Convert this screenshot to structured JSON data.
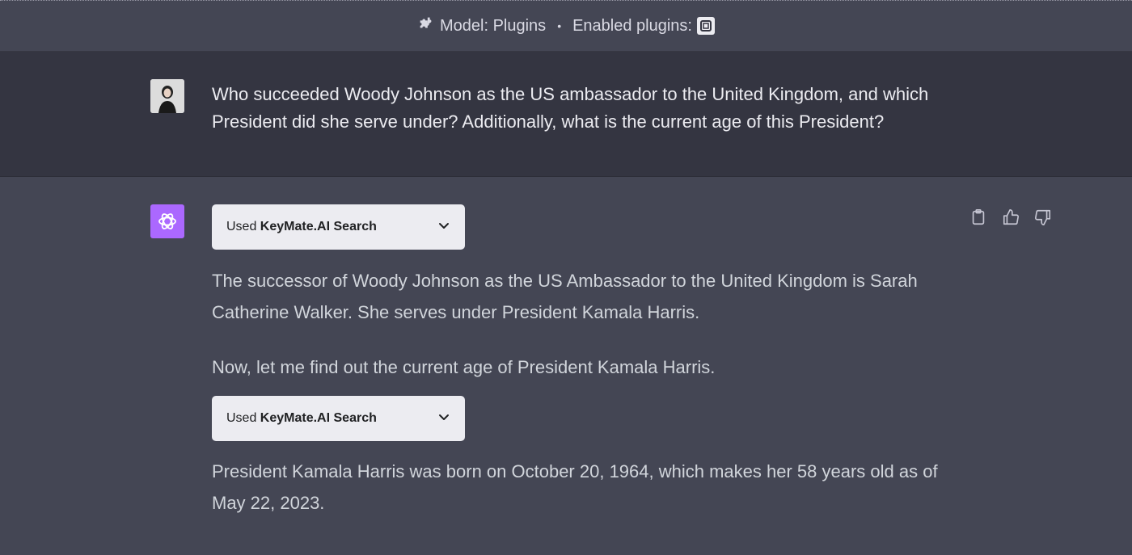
{
  "header": {
    "model_label": "Model: Plugins",
    "separator": "•",
    "enabled_label": "Enabled plugins:",
    "puzzle_icon": "puzzle-icon",
    "plugin_logo_icon": "keymate-logo-icon"
  },
  "user_message": {
    "avatar": "user-avatar",
    "text": "Who succeeded Woody Johnson as the US ambassador to the United Kingdom, and which President did she serve under? Additionally, what is the current age of this President?"
  },
  "assistant_message": {
    "avatar": "openai-logo-icon",
    "plugin_calls": [
      {
        "prefix": "Used ",
        "name": "KeyMate.AI Search"
      },
      {
        "prefix": "Used ",
        "name": "KeyMate.AI Search"
      }
    ],
    "paragraphs": [
      "The successor of Woody Johnson as the US Ambassador to the United Kingdom is Sarah Catherine Walker. She serves under President Kamala Harris.",
      "Now, let me find out the current age of President Kamala Harris.",
      "President Kamala Harris was born on October 20, 1964, which makes her 58 years old as of May 22, 2023."
    ],
    "actions": [
      "clipboard-icon",
      "thumbs-up-icon",
      "thumbs-down-icon"
    ]
  },
  "colors": {
    "background": "#444654",
    "user_row": "#343541",
    "gpt_avatar": "#ab68ff",
    "plugin_button": "#ececf1"
  }
}
